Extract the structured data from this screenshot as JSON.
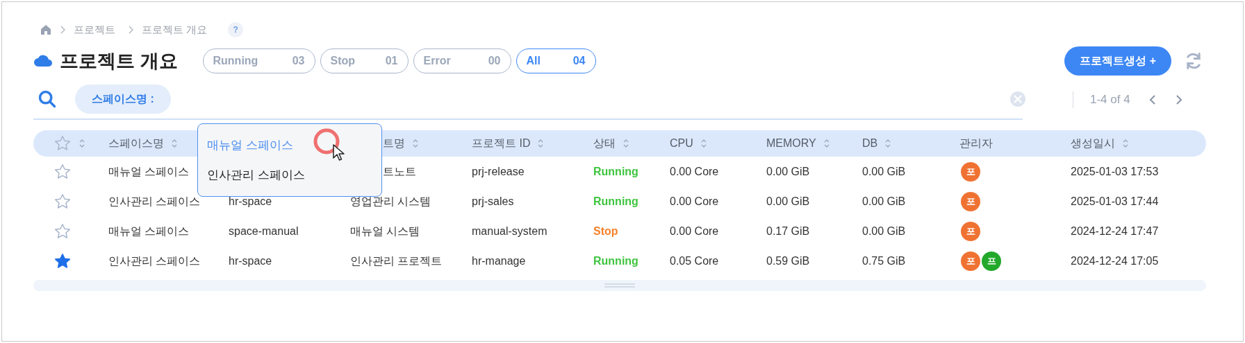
{
  "breadcrumb": [
    "프로젝트",
    "프로젝트 개요"
  ],
  "help": "?",
  "title": "프로젝트 개요",
  "status_filters": [
    {
      "label": "Running",
      "count": "03",
      "selected": false
    },
    {
      "label": "Stop",
      "count": "01",
      "selected": false
    },
    {
      "label": "Error",
      "count": "00",
      "selected": false
    },
    {
      "label": "All",
      "count": "04",
      "selected": true
    }
  ],
  "create_button": "프로젝트생성 +",
  "search": {
    "chip": "스페이스명 :"
  },
  "pagination": {
    "range": "1-4 of 4"
  },
  "dropdown": [
    {
      "label": "매뉴얼 스페이스",
      "selected": true
    },
    {
      "label": "인사관리 스페이스",
      "selected": false
    }
  ],
  "table": {
    "columns": [
      {
        "sortable": true
      },
      {
        "label": "스페이스명",
        "sortable": true
      },
      {
        "label": "트명",
        "sortable": true,
        "cut": true
      },
      {
        "label": "프로젝트 ID",
        "sortable": true
      },
      {
        "label": "상태",
        "sortable": true
      },
      {
        "label": "CPU",
        "sortable": true
      },
      {
        "label": "MEMORY",
        "sortable": true
      },
      {
        "label": "DB",
        "sortable": true
      },
      {
        "label": "관리자",
        "sortable": false
      },
      {
        "label": "생성일시",
        "sortable": true
      }
    ],
    "rows": [
      {
        "starred": false,
        "space": "매뉴얼 스페이스",
        "project": "트노트",
        "cut": true,
        "id": "prj-release",
        "status": {
          "text": "Running",
          "kind": "running"
        },
        "cpu": "0.00 Core",
        "memory": "0.00 GiB",
        "db": "0.00 GiB",
        "managers": [
          {
            "initial": "포",
            "color": "#f07232"
          }
        ],
        "created": "2025-01-03 17:53"
      },
      {
        "starred": false,
        "space": "인사관리 스페이스",
        "code": "hr-space",
        "project": "영업관리 시스템",
        "id": "prj-sales",
        "status": {
          "text": "Running",
          "kind": "running"
        },
        "cpu": "0.00 Core",
        "memory": "0.00 GiB",
        "db": "0.00 GiB",
        "managers": [
          {
            "initial": "포",
            "color": "#f07232"
          }
        ],
        "created": "2025-01-03 17:44"
      },
      {
        "starred": false,
        "space": "매뉴얼 스페이스",
        "code": "space-manual",
        "project": "매뉴얼 시스템",
        "id": "manual-system",
        "status": {
          "text": "Stop",
          "kind": "stop"
        },
        "cpu": "0.00 Core",
        "memory": "0.17 GiB",
        "db": "0.00 GiB",
        "managers": [
          {
            "initial": "포",
            "color": "#f07232"
          }
        ],
        "created": "2024-12-24 17:47"
      },
      {
        "starred": true,
        "space": "인사관리 스페이스",
        "code": "hr-space",
        "project": "인사관리 프로젝트",
        "id": "hr-manage",
        "status": {
          "text": "Running",
          "kind": "running"
        },
        "cpu": "0.05 Core",
        "memory": "0.59 GiB",
        "db": "0.75 GiB",
        "managers": [
          {
            "initial": "포",
            "color": "#f07232"
          },
          {
            "initial": "프",
            "color": "#22a82a"
          }
        ],
        "created": "2024-12-24 17:05"
      }
    ]
  }
}
